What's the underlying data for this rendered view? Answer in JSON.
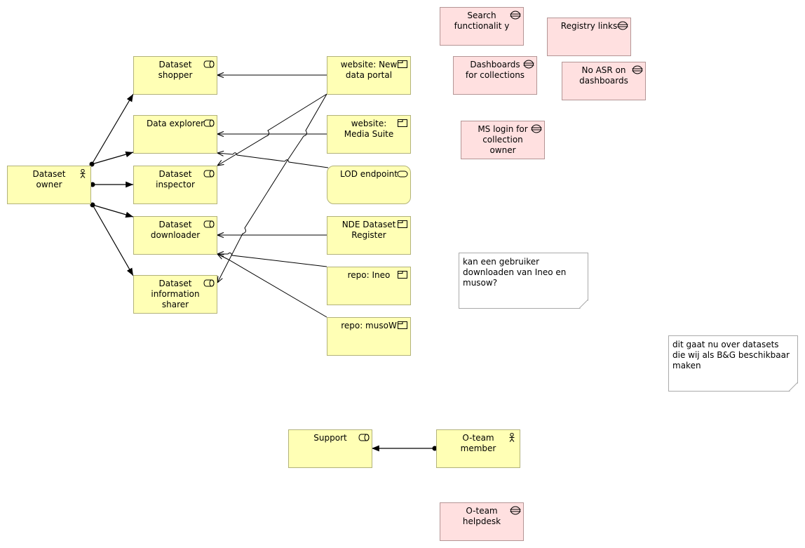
{
  "colors": {
    "business_fill": "#ffffb5",
    "business_border": "#b2b27a",
    "requirement_fill": "#ffe0e0",
    "requirement_border": "#b49595",
    "note_border": "#aaaaaa"
  },
  "elements": {
    "dataset_owner": {
      "label": "Dataset owner",
      "type": "business-actor",
      "icon": "actor-icon"
    },
    "dataset_shopper": {
      "label": "Dataset shopper",
      "type": "business-role",
      "icon": "role-icon"
    },
    "data_explorer": {
      "label": "Data explorer",
      "type": "business-role",
      "icon": "role-icon"
    },
    "dataset_inspector": {
      "label": "Dataset inspector",
      "type": "business-role",
      "icon": "role-icon"
    },
    "dataset_downloader": {
      "label": "Dataset downloader",
      "type": "business-role",
      "icon": "role-icon"
    },
    "dataset_information_sharer": {
      "label": "Dataset information sharer",
      "type": "business-role",
      "icon": "role-icon"
    },
    "website_new_data_portal": {
      "label": "website: New data portal",
      "type": "business-object",
      "icon": "object-icon"
    },
    "website_media_suite": {
      "label": "website: Media Suite",
      "type": "business-object",
      "icon": "object-icon"
    },
    "lod_endpoint": {
      "label": "LOD endpoint",
      "type": "business-service",
      "icon": "service-icon"
    },
    "nde_dataset_register": {
      "label": "NDE Dataset Register",
      "type": "business-object",
      "icon": "object-icon"
    },
    "repo_ineo": {
      "label": "repo: Ineo",
      "type": "business-object",
      "icon": "object-icon"
    },
    "repo_musow": {
      "label": "repo: musoW",
      "type": "business-object",
      "icon": "object-icon"
    },
    "search_functionality": {
      "label": "Search functionalit y",
      "type": "requirement",
      "icon": "constraint-icon"
    },
    "registry_links": {
      "label": "Registry links",
      "type": "requirement",
      "icon": "constraint-icon"
    },
    "dashboards_for_collections": {
      "label": "Dashboards for collections",
      "type": "requirement",
      "icon": "constraint-icon"
    },
    "no_asr_on_dashboards": {
      "label": "No ASR on dashboards",
      "type": "requirement",
      "icon": "constraint-icon"
    },
    "ms_login": {
      "label": "MS login for collection owner",
      "type": "requirement",
      "icon": "constraint-icon"
    },
    "support": {
      "label": "Support",
      "type": "business-role",
      "icon": "role-icon"
    },
    "oteam_member": {
      "label": "O-team member",
      "type": "business-actor",
      "icon": "actor-icon"
    },
    "oteam_helpdesk": {
      "label": "O-team helpdesk",
      "type": "requirement",
      "icon": "constraint-icon"
    }
  },
  "notes": {
    "note_ineo_musow": "kan een gebruiker downloaden van Ineo en musow?",
    "note_datasets": "dit gaat nu over datasets die wij als B&G beschikbaar maken"
  },
  "relations": [
    {
      "from": "dataset_owner",
      "to": "dataset_shopper",
      "type": "assignment"
    },
    {
      "from": "dataset_owner",
      "to": "data_explorer",
      "type": "assignment"
    },
    {
      "from": "dataset_owner",
      "to": "dataset_inspector",
      "type": "assignment"
    },
    {
      "from": "dataset_owner",
      "to": "dataset_downloader",
      "type": "assignment"
    },
    {
      "from": "dataset_owner",
      "to": "dataset_information_sharer",
      "type": "assignment"
    },
    {
      "from": "website_new_data_portal",
      "to": "dataset_shopper",
      "type": "serving"
    },
    {
      "from": "website_new_data_portal",
      "to": "dataset_inspector",
      "type": "serving"
    },
    {
      "from": "website_new_data_portal",
      "to": "dataset_information_sharer",
      "type": "serving"
    },
    {
      "from": "website_media_suite",
      "to": "data_explorer",
      "type": "serving"
    },
    {
      "from": "lod_endpoint",
      "to": "data_explorer",
      "type": "serving"
    },
    {
      "from": "nde_dataset_register",
      "to": "dataset_downloader",
      "type": "serving"
    },
    {
      "from": "repo_ineo",
      "to": "dataset_downloader",
      "type": "serving"
    },
    {
      "from": "repo_musow",
      "to": "dataset_downloader",
      "type": "serving"
    },
    {
      "from": "oteam_member",
      "to": "support",
      "type": "assignment"
    }
  ]
}
